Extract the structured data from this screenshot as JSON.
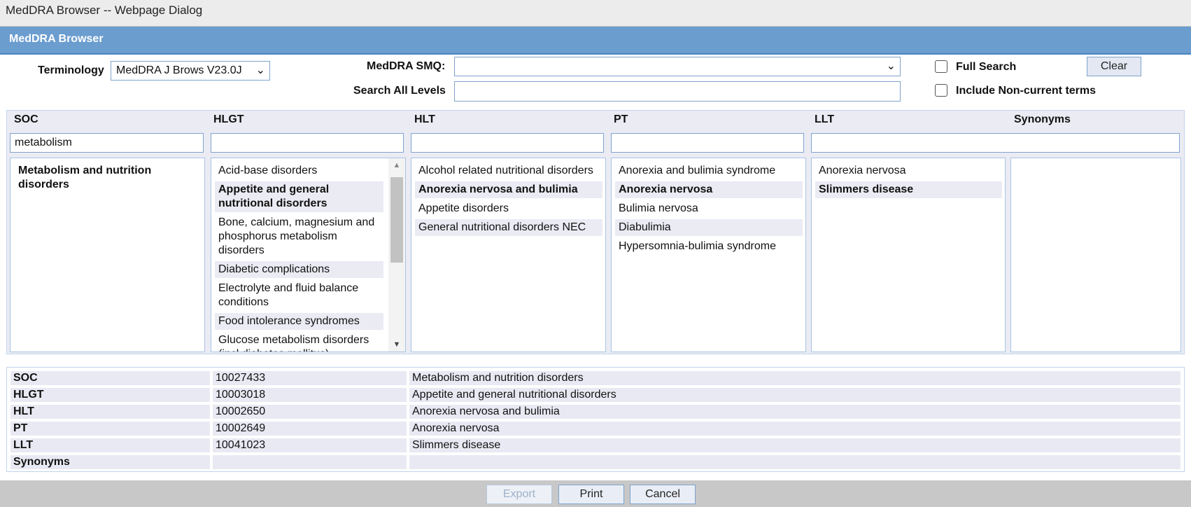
{
  "window": {
    "title": "MedDRA Browser -- Webpage Dialog"
  },
  "header": {
    "title": "MedDRA Browser"
  },
  "controls": {
    "terminology_label": "Terminology",
    "terminology_value": "MedDRA J Brows V23.0J",
    "smq_label": "MedDRA SMQ:",
    "smq_value": "",
    "search_all_label": "Search All Levels",
    "search_all_value": "",
    "full_search_label": "Full Search",
    "include_noncurrent_label": "Include Non-current terms",
    "clear_label": "Clear"
  },
  "columns": {
    "soc": {
      "header": "SOC",
      "filter": "metabolism",
      "items": [
        "Metabolism and nutrition disorders"
      ]
    },
    "hlgt": {
      "header": "HLGT",
      "filter": "",
      "items": [
        "Acid-base disorders",
        "Appetite and general nutritional disorders",
        "Bone, calcium, magnesium and phosphorus metabolism disorders",
        "Diabetic complications",
        "Electrolyte and fluid balance conditions",
        "Food intolerance syndromes",
        "Glucose metabolism disorders (incl diabetes mellitus)"
      ]
    },
    "hlt": {
      "header": "HLT",
      "filter": "",
      "items": [
        "Alcohol related nutritional disorders",
        "Anorexia nervosa and bulimia",
        "Appetite disorders",
        "General nutritional disorders NEC"
      ]
    },
    "pt": {
      "header": "PT",
      "filter": "",
      "items": [
        "Anorexia and bulimia syndrome",
        "Anorexia nervosa",
        "Bulimia nervosa",
        "Diabulimia",
        "Hypersomnia-bulimia syndrome"
      ]
    },
    "llt": {
      "header": "LLT",
      "filter": "",
      "items": [
        "Anorexia nervosa",
        "Slimmers disease"
      ]
    },
    "synonyms": {
      "header": "Synonyms",
      "items": []
    }
  },
  "details": [
    {
      "level": "SOC",
      "code": "10027433",
      "name": "Metabolism and nutrition disorders"
    },
    {
      "level": "HLGT",
      "code": "10003018",
      "name": "Appetite and general nutritional disorders"
    },
    {
      "level": "HLT",
      "code": "10002650",
      "name": "Anorexia nervosa and bulimia"
    },
    {
      "level": "PT",
      "code": "10002649",
      "name": "Anorexia nervosa"
    },
    {
      "level": "LLT",
      "code": "10041023",
      "name": "Slimmers disease"
    },
    {
      "level": "Synonyms",
      "code": "",
      "name": ""
    }
  ],
  "footer": {
    "export_label": "Export",
    "print_label": "Print",
    "cancel_label": "Cancel"
  },
  "colors": {
    "header_bg": "#6b9dcf",
    "panel_bg": "#ebebf4",
    "border": "#a9c4e2",
    "footer_bg": "#c8c8c8"
  }
}
